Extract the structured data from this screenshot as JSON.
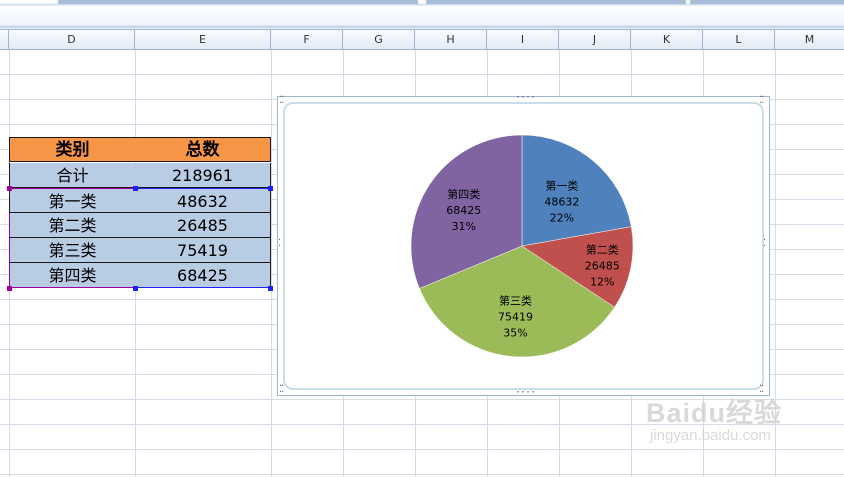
{
  "columns": [
    "D",
    "E",
    "F",
    "G",
    "H",
    "I",
    "J",
    "K",
    "L",
    "M"
  ],
  "table": {
    "headers": [
      "类别",
      "总数"
    ],
    "rows": [
      [
        "合计",
        "218961"
      ],
      [
        "第一类",
        "48632"
      ],
      [
        "第二类",
        "26485"
      ],
      [
        "第三类",
        "75419"
      ],
      [
        "第四类",
        "68425"
      ]
    ]
  },
  "chart_data": {
    "type": "pie",
    "categories": [
      "第一类",
      "第二类",
      "第三类",
      "第四类"
    ],
    "values": [
      48632,
      26485,
      75419,
      68425
    ],
    "percent_labels": [
      "22%",
      "12%",
      "35%",
      "31%"
    ],
    "value_labels": [
      "48632",
      "26485",
      "75419",
      "68425"
    ],
    "colors": [
      "#4f81bd",
      "#c0504d",
      "#9bbb59",
      "#8064a2"
    ]
  },
  "watermark": {
    "logo": "Baidu经验",
    "url": "jingyan.baidu.com"
  }
}
